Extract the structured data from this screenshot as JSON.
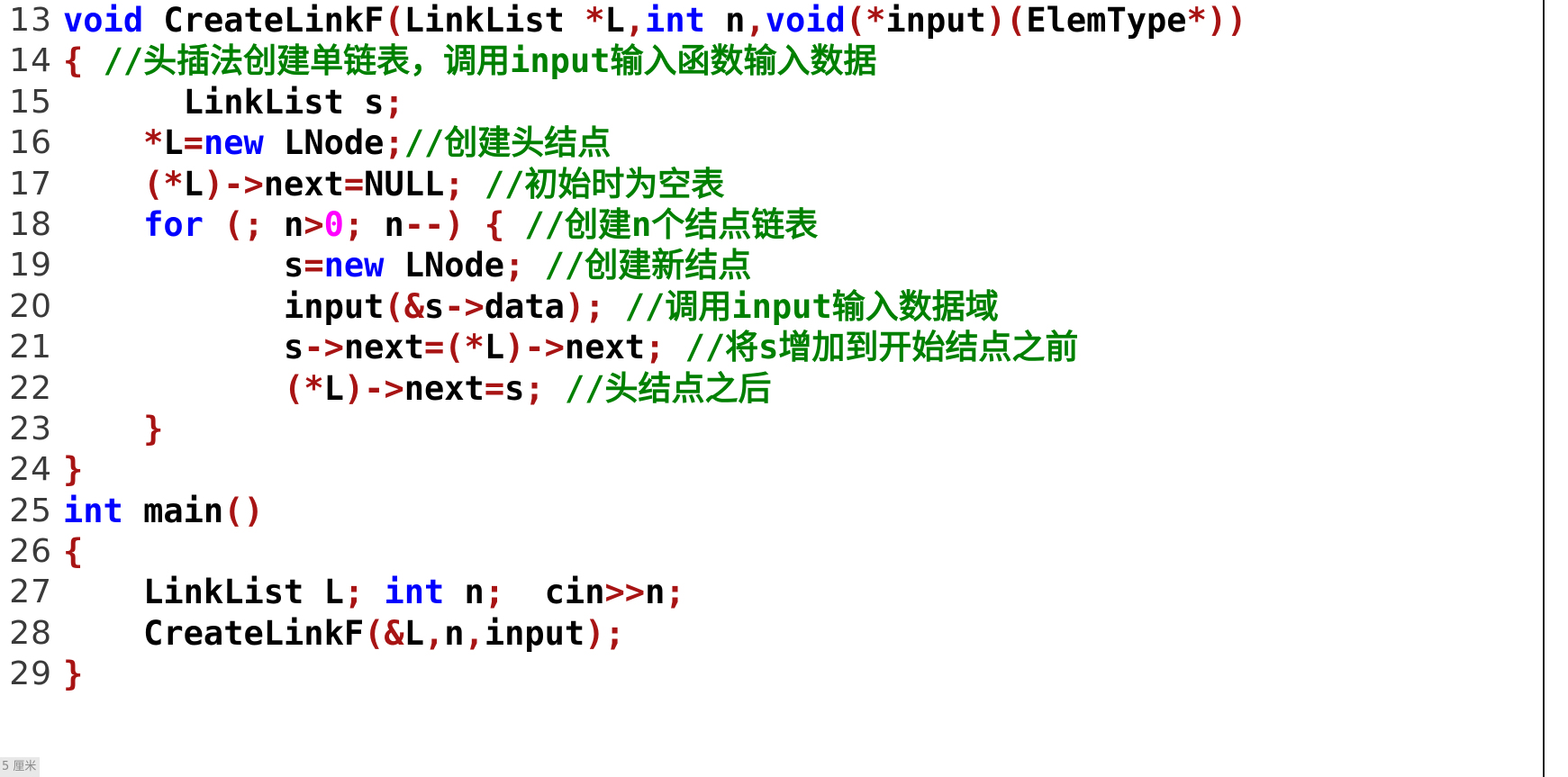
{
  "editor": {
    "name": "code-editor",
    "language": "C++",
    "first_line_number": 13,
    "last_line_number": 29,
    "colors": {
      "background": "#ffffff",
      "plain": "#000000",
      "keyword": "#0000ff",
      "punctuation": "#a81414",
      "comment": "#008000",
      "number": "#ff00ff",
      "gutter": "#3a3a3a",
      "divider": "#1c1c1c"
    }
  },
  "ruler_chip": {
    "label": "5 厘米"
  },
  "lines": [
    {
      "number": "13",
      "text": "void CreateLinkF(LinkList *L,int n,void(*input)(ElemType*))",
      "tokens": [
        {
          "t": "void",
          "c": "kw"
        },
        {
          "t": " ",
          "c": "pln"
        },
        {
          "t": "CreateLinkF",
          "c": "pln"
        },
        {
          "t": "(",
          "c": "pun"
        },
        {
          "t": "LinkList ",
          "c": "pln"
        },
        {
          "t": "*",
          "c": "pun"
        },
        {
          "t": "L",
          "c": "pln"
        },
        {
          "t": ",",
          "c": "pun"
        },
        {
          "t": "int",
          "c": "kw"
        },
        {
          "t": " n",
          "c": "pln"
        },
        {
          "t": ",",
          "c": "pun"
        },
        {
          "t": "void",
          "c": "kw"
        },
        {
          "t": "(*",
          "c": "pun"
        },
        {
          "t": "input",
          "c": "pln"
        },
        {
          "t": ")(",
          "c": "pun"
        },
        {
          "t": "ElemType",
          "c": "pln"
        },
        {
          "t": "*",
          "c": "pun"
        },
        {
          "t": "))",
          "c": "pun"
        }
      ]
    },
    {
      "number": "14",
      "text": "{ //头插法创建单链表，调用input输入函数输入数据",
      "tokens": [
        {
          "t": "{",
          "c": "pun"
        },
        {
          "t": " ",
          "c": "pln"
        },
        {
          "t": "//头插法创建单链表，调用input输入函数输入数据",
          "c": "cmt"
        }
      ]
    },
    {
      "number": "15",
      "text": "      LinkList s;",
      "tokens": [
        {
          "t": "      LinkList s",
          "c": "pln"
        },
        {
          "t": ";",
          "c": "pun"
        }
      ]
    },
    {
      "number": "16",
      "text": "    *L=new LNode;//创建头结点",
      "tokens": [
        {
          "t": "    ",
          "c": "pln"
        },
        {
          "t": "*",
          "c": "pun"
        },
        {
          "t": "L",
          "c": "pln"
        },
        {
          "t": "=",
          "c": "pun"
        },
        {
          "t": "new",
          "c": "kw"
        },
        {
          "t": " LNode",
          "c": "pln"
        },
        {
          "t": ";",
          "c": "pun"
        },
        {
          "t": "//创建头结点",
          "c": "cmt"
        }
      ]
    },
    {
      "number": "17",
      "text": "    (*L)->next=NULL; //初始时为空表",
      "tokens": [
        {
          "t": "    ",
          "c": "pln"
        },
        {
          "t": "(*",
          "c": "pun"
        },
        {
          "t": "L",
          "c": "pln"
        },
        {
          "t": ")->",
          "c": "pun"
        },
        {
          "t": "next",
          "c": "pln"
        },
        {
          "t": "=",
          "c": "pun"
        },
        {
          "t": "NULL",
          "c": "pln"
        },
        {
          "t": ";",
          "c": "pun"
        },
        {
          "t": " ",
          "c": "pln"
        },
        {
          "t": "//初始时为空表",
          "c": "cmt"
        }
      ]
    },
    {
      "number": "18",
      "text": "    for (; n>0; n--) { //创建n个结点链表",
      "tokens": [
        {
          "t": "    ",
          "c": "pln"
        },
        {
          "t": "for",
          "c": "kw"
        },
        {
          "t": " ",
          "c": "pln"
        },
        {
          "t": "(;",
          "c": "pun"
        },
        {
          "t": " n",
          "c": "pln"
        },
        {
          "t": ">",
          "c": "pun"
        },
        {
          "t": "0",
          "c": "num"
        },
        {
          "t": ";",
          "c": "pun"
        },
        {
          "t": " n",
          "c": "pln"
        },
        {
          "t": "--)",
          "c": "pun"
        },
        {
          "t": " ",
          "c": "pln"
        },
        {
          "t": "{",
          "c": "pun"
        },
        {
          "t": " ",
          "c": "pln"
        },
        {
          "t": "//创建n个结点链表",
          "c": "cmt"
        }
      ]
    },
    {
      "number": "19",
      "text": "           s=new LNode; //创建新结点",
      "tokens": [
        {
          "t": "           s",
          "c": "pln"
        },
        {
          "t": "=",
          "c": "pun"
        },
        {
          "t": "new",
          "c": "kw"
        },
        {
          "t": " LNode",
          "c": "pln"
        },
        {
          "t": ";",
          "c": "pun"
        },
        {
          "t": " ",
          "c": "pln"
        },
        {
          "t": "//创建新结点",
          "c": "cmt"
        }
      ]
    },
    {
      "number": "20",
      "text": "           input(&s->data); //调用input输入数据域",
      "tokens": [
        {
          "t": "           input",
          "c": "pln"
        },
        {
          "t": "(&",
          "c": "pun"
        },
        {
          "t": "s",
          "c": "pln"
        },
        {
          "t": "->",
          "c": "pun"
        },
        {
          "t": "data",
          "c": "pln"
        },
        {
          "t": ");",
          "c": "pun"
        },
        {
          "t": " ",
          "c": "pln"
        },
        {
          "t": "//调用input输入数据域",
          "c": "cmt"
        }
      ]
    },
    {
      "number": "21",
      "text": "           s->next=(*L)->next; //将s增加到开始结点之前",
      "tokens": [
        {
          "t": "           s",
          "c": "pln"
        },
        {
          "t": "->",
          "c": "pun"
        },
        {
          "t": "next",
          "c": "pln"
        },
        {
          "t": "=(*",
          "c": "pun"
        },
        {
          "t": "L",
          "c": "pln"
        },
        {
          "t": ")->",
          "c": "pun"
        },
        {
          "t": "next",
          "c": "pln"
        },
        {
          "t": ";",
          "c": "pun"
        },
        {
          "t": " ",
          "c": "pln"
        },
        {
          "t": "//将s增加到开始结点之前",
          "c": "cmt"
        }
      ]
    },
    {
      "number": "22",
      "text": "           (*L)->next=s; //头结点之后",
      "tokens": [
        {
          "t": "           ",
          "c": "pln"
        },
        {
          "t": "(*",
          "c": "pun"
        },
        {
          "t": "L",
          "c": "pln"
        },
        {
          "t": ")->",
          "c": "pun"
        },
        {
          "t": "next",
          "c": "pln"
        },
        {
          "t": "=",
          "c": "pun"
        },
        {
          "t": "s",
          "c": "pln"
        },
        {
          "t": ";",
          "c": "pun"
        },
        {
          "t": " ",
          "c": "pln"
        },
        {
          "t": "//头结点之后",
          "c": "cmt"
        }
      ]
    },
    {
      "number": "23",
      "text": "    }",
      "tokens": [
        {
          "t": "    ",
          "c": "pln"
        },
        {
          "t": "}",
          "c": "pun"
        }
      ]
    },
    {
      "number": "24",
      "text": "}",
      "tokens": [
        {
          "t": "}",
          "c": "pun"
        }
      ]
    },
    {
      "number": "25",
      "text": "int main()",
      "tokens": [
        {
          "t": "int",
          "c": "kw"
        },
        {
          "t": " main",
          "c": "pln"
        },
        {
          "t": "()",
          "c": "pun"
        }
      ]
    },
    {
      "number": "26",
      "text": "{",
      "tokens": [
        {
          "t": "{",
          "c": "pun"
        }
      ]
    },
    {
      "number": "27",
      "text": "    LinkList L; int n;  cin>>n;",
      "tokens": [
        {
          "t": "    LinkList L",
          "c": "pln"
        },
        {
          "t": ";",
          "c": "pun"
        },
        {
          "t": " ",
          "c": "pln"
        },
        {
          "t": "int",
          "c": "kw"
        },
        {
          "t": " n",
          "c": "pln"
        },
        {
          "t": ";",
          "c": "pun"
        },
        {
          "t": "  cin",
          "c": "pln"
        },
        {
          "t": ">>",
          "c": "pun"
        },
        {
          "t": "n",
          "c": "pln"
        },
        {
          "t": ";",
          "c": "pun"
        }
      ]
    },
    {
      "number": "28",
      "text": "    CreateLinkF(&L,n,input);",
      "tokens": [
        {
          "t": "    CreateLinkF",
          "c": "pln"
        },
        {
          "t": "(&",
          "c": "pun"
        },
        {
          "t": "L",
          "c": "pln"
        },
        {
          "t": ",",
          "c": "pun"
        },
        {
          "t": "n",
          "c": "pln"
        },
        {
          "t": ",",
          "c": "pun"
        },
        {
          "t": "input",
          "c": "pln"
        },
        {
          "t": ");",
          "c": "pun"
        }
      ]
    },
    {
      "number": "29",
      "text": "}",
      "tokens": [
        {
          "t": "}",
          "c": "pun"
        }
      ]
    }
  ]
}
